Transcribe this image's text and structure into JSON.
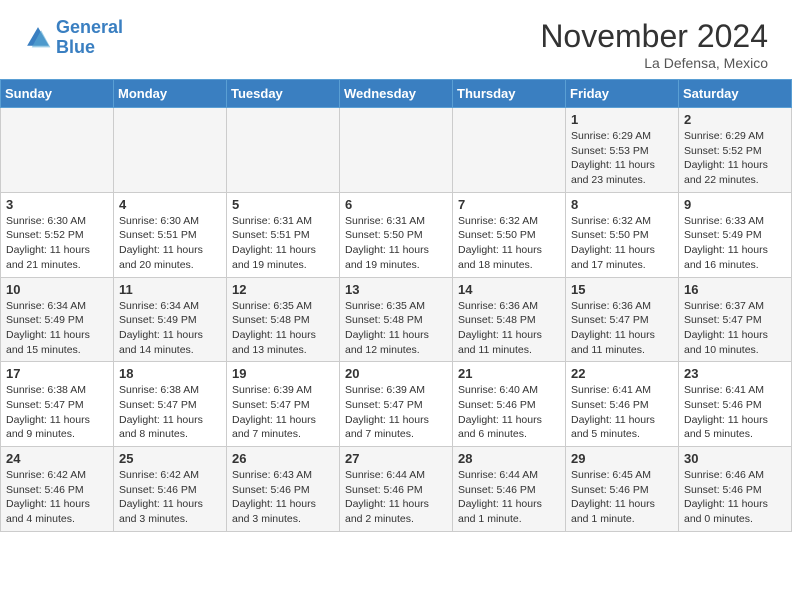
{
  "header": {
    "logo_line1": "General",
    "logo_line2": "Blue",
    "month_title": "November 2024",
    "location": "La Defensa, Mexico"
  },
  "weekdays": [
    "Sunday",
    "Monday",
    "Tuesday",
    "Wednesday",
    "Thursday",
    "Friday",
    "Saturday"
  ],
  "weeks": [
    [
      {
        "day": "",
        "sunrise": "",
        "sunset": "",
        "daylight": ""
      },
      {
        "day": "",
        "sunrise": "",
        "sunset": "",
        "daylight": ""
      },
      {
        "day": "",
        "sunrise": "",
        "sunset": "",
        "daylight": ""
      },
      {
        "day": "",
        "sunrise": "",
        "sunset": "",
        "daylight": ""
      },
      {
        "day": "",
        "sunrise": "",
        "sunset": "",
        "daylight": ""
      },
      {
        "day": "1",
        "sunrise": "Sunrise: 6:29 AM",
        "sunset": "Sunset: 5:53 PM",
        "daylight": "Daylight: 11 hours and 23 minutes."
      },
      {
        "day": "2",
        "sunrise": "Sunrise: 6:29 AM",
        "sunset": "Sunset: 5:52 PM",
        "daylight": "Daylight: 11 hours and 22 minutes."
      }
    ],
    [
      {
        "day": "3",
        "sunrise": "Sunrise: 6:30 AM",
        "sunset": "Sunset: 5:52 PM",
        "daylight": "Daylight: 11 hours and 21 minutes."
      },
      {
        "day": "4",
        "sunrise": "Sunrise: 6:30 AM",
        "sunset": "Sunset: 5:51 PM",
        "daylight": "Daylight: 11 hours and 20 minutes."
      },
      {
        "day": "5",
        "sunrise": "Sunrise: 6:31 AM",
        "sunset": "Sunset: 5:51 PM",
        "daylight": "Daylight: 11 hours and 19 minutes."
      },
      {
        "day": "6",
        "sunrise": "Sunrise: 6:31 AM",
        "sunset": "Sunset: 5:50 PM",
        "daylight": "Daylight: 11 hours and 19 minutes."
      },
      {
        "day": "7",
        "sunrise": "Sunrise: 6:32 AM",
        "sunset": "Sunset: 5:50 PM",
        "daylight": "Daylight: 11 hours and 18 minutes."
      },
      {
        "day": "8",
        "sunrise": "Sunrise: 6:32 AM",
        "sunset": "Sunset: 5:50 PM",
        "daylight": "Daylight: 11 hours and 17 minutes."
      },
      {
        "day": "9",
        "sunrise": "Sunrise: 6:33 AM",
        "sunset": "Sunset: 5:49 PM",
        "daylight": "Daylight: 11 hours and 16 minutes."
      }
    ],
    [
      {
        "day": "10",
        "sunrise": "Sunrise: 6:34 AM",
        "sunset": "Sunset: 5:49 PM",
        "daylight": "Daylight: 11 hours and 15 minutes."
      },
      {
        "day": "11",
        "sunrise": "Sunrise: 6:34 AM",
        "sunset": "Sunset: 5:49 PM",
        "daylight": "Daylight: 11 hours and 14 minutes."
      },
      {
        "day": "12",
        "sunrise": "Sunrise: 6:35 AM",
        "sunset": "Sunset: 5:48 PM",
        "daylight": "Daylight: 11 hours and 13 minutes."
      },
      {
        "day": "13",
        "sunrise": "Sunrise: 6:35 AM",
        "sunset": "Sunset: 5:48 PM",
        "daylight": "Daylight: 11 hours and 12 minutes."
      },
      {
        "day": "14",
        "sunrise": "Sunrise: 6:36 AM",
        "sunset": "Sunset: 5:48 PM",
        "daylight": "Daylight: 11 hours and 11 minutes."
      },
      {
        "day": "15",
        "sunrise": "Sunrise: 6:36 AM",
        "sunset": "Sunset: 5:47 PM",
        "daylight": "Daylight: 11 hours and 11 minutes."
      },
      {
        "day": "16",
        "sunrise": "Sunrise: 6:37 AM",
        "sunset": "Sunset: 5:47 PM",
        "daylight": "Daylight: 11 hours and 10 minutes."
      }
    ],
    [
      {
        "day": "17",
        "sunrise": "Sunrise: 6:38 AM",
        "sunset": "Sunset: 5:47 PM",
        "daylight": "Daylight: 11 hours and 9 minutes."
      },
      {
        "day": "18",
        "sunrise": "Sunrise: 6:38 AM",
        "sunset": "Sunset: 5:47 PM",
        "daylight": "Daylight: 11 hours and 8 minutes."
      },
      {
        "day": "19",
        "sunrise": "Sunrise: 6:39 AM",
        "sunset": "Sunset: 5:47 PM",
        "daylight": "Daylight: 11 hours and 7 minutes."
      },
      {
        "day": "20",
        "sunrise": "Sunrise: 6:39 AM",
        "sunset": "Sunset: 5:47 PM",
        "daylight": "Daylight: 11 hours and 7 minutes."
      },
      {
        "day": "21",
        "sunrise": "Sunrise: 6:40 AM",
        "sunset": "Sunset: 5:46 PM",
        "daylight": "Daylight: 11 hours and 6 minutes."
      },
      {
        "day": "22",
        "sunrise": "Sunrise: 6:41 AM",
        "sunset": "Sunset: 5:46 PM",
        "daylight": "Daylight: 11 hours and 5 minutes."
      },
      {
        "day": "23",
        "sunrise": "Sunrise: 6:41 AM",
        "sunset": "Sunset: 5:46 PM",
        "daylight": "Daylight: 11 hours and 5 minutes."
      }
    ],
    [
      {
        "day": "24",
        "sunrise": "Sunrise: 6:42 AM",
        "sunset": "Sunset: 5:46 PM",
        "daylight": "Daylight: 11 hours and 4 minutes."
      },
      {
        "day": "25",
        "sunrise": "Sunrise: 6:42 AM",
        "sunset": "Sunset: 5:46 PM",
        "daylight": "Daylight: 11 hours and 3 minutes."
      },
      {
        "day": "26",
        "sunrise": "Sunrise: 6:43 AM",
        "sunset": "Sunset: 5:46 PM",
        "daylight": "Daylight: 11 hours and 3 minutes."
      },
      {
        "day": "27",
        "sunrise": "Sunrise: 6:44 AM",
        "sunset": "Sunset: 5:46 PM",
        "daylight": "Daylight: 11 hours and 2 minutes."
      },
      {
        "day": "28",
        "sunrise": "Sunrise: 6:44 AM",
        "sunset": "Sunset: 5:46 PM",
        "daylight": "Daylight: 11 hours and 1 minute."
      },
      {
        "day": "29",
        "sunrise": "Sunrise: 6:45 AM",
        "sunset": "Sunset: 5:46 PM",
        "daylight": "Daylight: 11 hours and 1 minute."
      },
      {
        "day": "30",
        "sunrise": "Sunrise: 6:46 AM",
        "sunset": "Sunset: 5:46 PM",
        "daylight": "Daylight: 11 hours and 0 minutes."
      }
    ]
  ]
}
